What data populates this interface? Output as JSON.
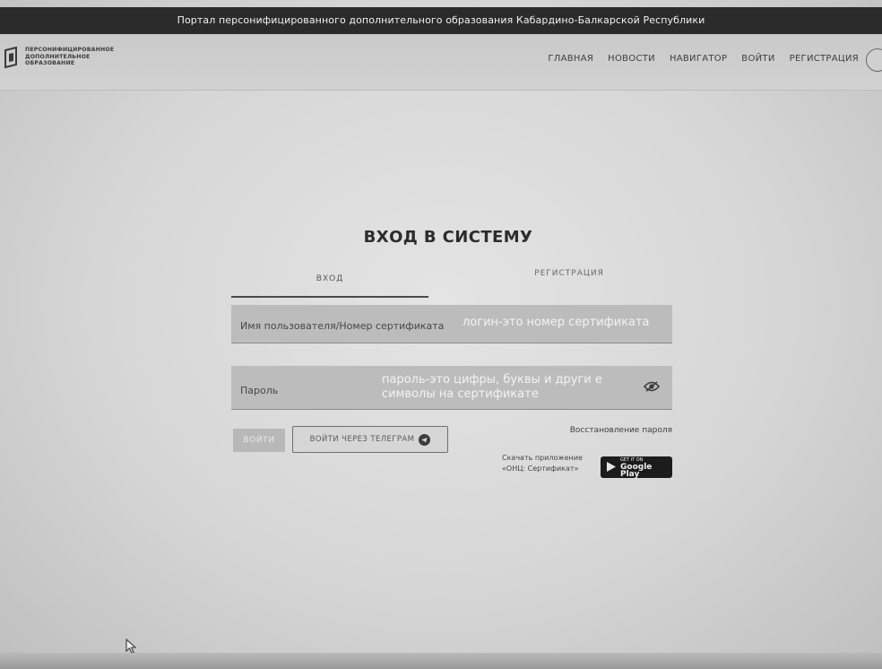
{
  "banner": {
    "text": "Портал персонифицированного дополнительного образования Кабардино-Балкарской Республики"
  },
  "logo": {
    "line1": "ПЕРСОНИФИЦИРОВАННОЕ",
    "line2": "ДОПОЛНИТЕЛЬНОЕ",
    "line3": "ОБРАЗОВАНИЕ"
  },
  "nav": {
    "items": [
      "ГЛАВНАЯ",
      "НОВОСТИ",
      "НАВИГАТОР",
      "ВОЙТИ",
      "РЕГИСТРАЦИЯ"
    ]
  },
  "page": {
    "title": "ВХОД В СИСТЕМУ"
  },
  "tabs": {
    "login": "ВХОД",
    "register": "РЕГИСТРАЦИЯ"
  },
  "form": {
    "username_label": "Имя пользователя/Номер сертификата",
    "username_hint": "логин-это номер сертификата",
    "password_label": "Пароль",
    "password_hint": "пароль-это цифры, буквы и други е символы на сертификате"
  },
  "actions": {
    "login_button": "ВОЙТИ",
    "telegram_button": "ВОЙТИ ЧЕРЕЗ ТЕЛЕГРАМ",
    "recover_link": "Восстановление пароля",
    "download_line1": "Скачать приложение",
    "download_line2": "«ОНЦ: Сертификат»",
    "gplay_small": "GET IT ON",
    "gplay_big": "Google Play"
  },
  "icons": {
    "logo": "logo-mark-icon",
    "eye": "eye-icon",
    "telegram": "telegram-icon",
    "play": "google-play-icon",
    "cursor": "mouse-cursor-icon"
  }
}
